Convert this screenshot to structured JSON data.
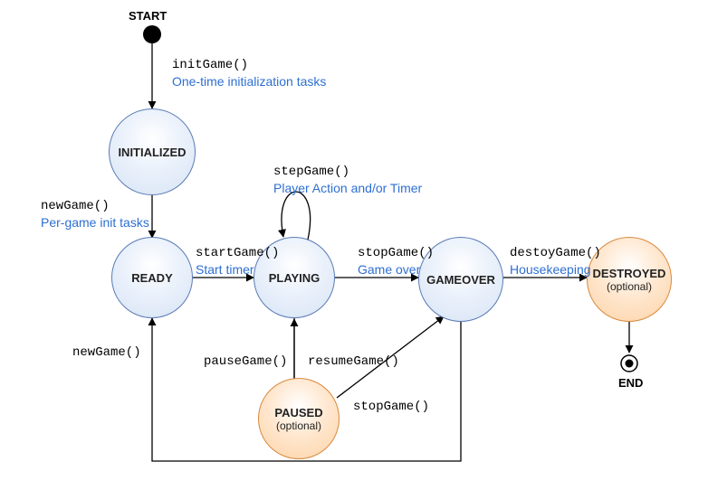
{
  "start_label": "START",
  "end_label": "END",
  "states": {
    "initialized": {
      "name": "INITIALIZED",
      "sub": ""
    },
    "ready": {
      "name": "READY",
      "sub": ""
    },
    "playing": {
      "name": "PLAYING",
      "sub": ""
    },
    "gameover": {
      "name": "GAMEOVER",
      "sub": ""
    },
    "paused": {
      "name": "PAUSED",
      "sub": "(optional)"
    },
    "destroyed": {
      "name": "DESTROYED",
      "sub": "(optional)"
    }
  },
  "transitions": {
    "init": {
      "method": "initGame()",
      "desc": "One-time initialization tasks"
    },
    "newgame": {
      "method": "newGame()",
      "desc": "Per-game init tasks"
    },
    "start": {
      "method": "startGame()",
      "desc": "Start timer"
    },
    "step": {
      "method": "stepGame()",
      "desc": "Player Action and/or Timer"
    },
    "stop": {
      "method": "stopGame()",
      "desc": "Game over"
    },
    "destroy": {
      "method": "destoyGame()",
      "desc": "Housekeeping"
    },
    "pause": {
      "method": "pauseGame()",
      "desc": ""
    },
    "resume": {
      "method": "resumeGame()",
      "desc": ""
    },
    "stop2": {
      "method": "stopGame()",
      "desc": ""
    },
    "newgame2": {
      "method": "newGame()",
      "desc": ""
    }
  },
  "colors": {
    "blue_text": "#2d6fd2",
    "node_blue_border": "#5a7bb5",
    "node_orange_border": "#d98a3d"
  }
}
